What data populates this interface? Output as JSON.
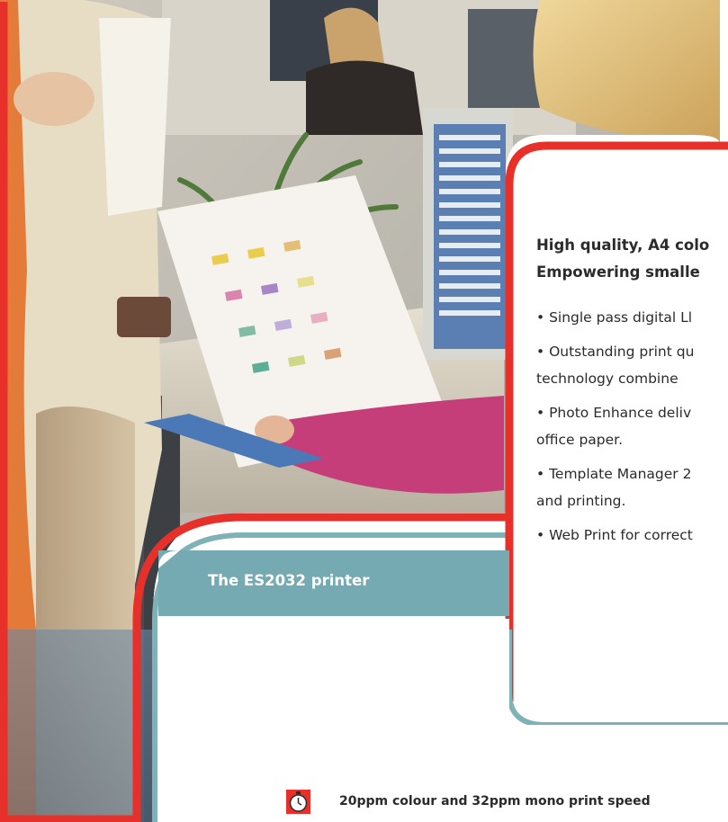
{
  "heading": {
    "line1": "High quality, A4 colo",
    "line2": "Empowering smalle"
  },
  "bullets": [
    {
      "lines": [
        "• Single pass digital Ll"
      ]
    },
    {
      "lines": [
        "• Outstanding print qu",
        "technology combine"
      ]
    },
    {
      "lines": [
        "• Photo Enhance deliv",
        "office paper."
      ]
    },
    {
      "lines": [
        "• Template Manager 2",
        "and printing."
      ]
    },
    {
      "lines": [
        "• Web Print for correct"
      ]
    }
  ],
  "section_label": "The ES2032 printer",
  "feature": {
    "icon": "stopwatch-icon",
    "text": "20ppm colour and 32ppm mono print speed"
  },
  "colors": {
    "accent_red": "#e8302a",
    "accent_teal": "#7fb2b6",
    "teal_label_bg": "#75aab2",
    "text": "#2b2b2b"
  }
}
